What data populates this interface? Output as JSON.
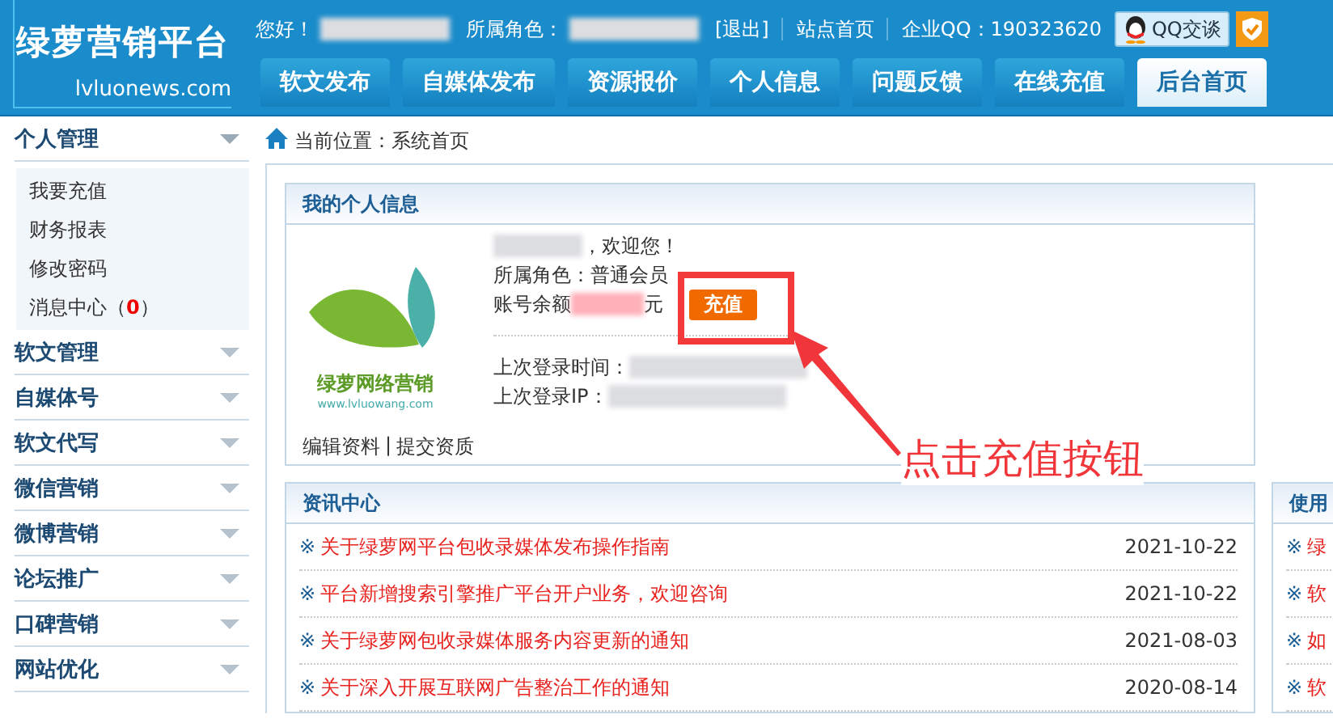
{
  "header": {
    "logo_title": "绿萝营销平台",
    "logo_domain": "lvluonews.com",
    "greeting": "您好！",
    "role_label": "所属角色：",
    "logout": "[退出]",
    "site_home": "站点首页",
    "company_qq": "企业QQ：190323620",
    "qq_chat": "QQ交谈"
  },
  "tabs": [
    {
      "label": "软文发布",
      "selected": false
    },
    {
      "label": "自媒体发布",
      "selected": false
    },
    {
      "label": "资源报价",
      "selected": false
    },
    {
      "label": "个人信息",
      "selected": false
    },
    {
      "label": "问题反馈",
      "selected": false
    },
    {
      "label": "在线充值",
      "selected": false
    },
    {
      "label": "后台首页",
      "selected": true
    }
  ],
  "sidebar": {
    "groups": [
      {
        "title": "个人管理",
        "expanded": true,
        "items": [
          {
            "label": "我要充值"
          },
          {
            "label": "财务报表"
          },
          {
            "label": "修改密码"
          },
          {
            "label": "消息中心（",
            "count": "0",
            "suffix": "）"
          }
        ]
      },
      {
        "title": "软文管理",
        "expanded": false
      },
      {
        "title": "自媒体号",
        "expanded": false
      },
      {
        "title": "软文代写",
        "expanded": false
      },
      {
        "title": "微信营销",
        "expanded": false
      },
      {
        "title": "微博营销",
        "expanded": false
      },
      {
        "title": "论坛推广",
        "expanded": false
      },
      {
        "title": "口碑营销",
        "expanded": false
      },
      {
        "title": "网站优化",
        "expanded": false
      }
    ]
  },
  "breadcrumb": "当前位置：系统首页",
  "profile": {
    "title": "我的个人信息",
    "logo_text": "绿萝网络营销",
    "logo_url": "www.lvluowang.com",
    "welcome": "，欢迎您！",
    "role": "所属角色：普通会员",
    "balance_label": "账号余额",
    "balance_unit": "元",
    "recharge_button": "充值",
    "last_login_time": "上次登录时间：",
    "last_login_ip": "上次登录IP：",
    "edit_link": "编辑资料",
    "separator": "|",
    "qualification_link": "提交资质"
  },
  "news": {
    "title": "资讯中心",
    "items": [
      {
        "mark": "※",
        "title": "关于绿萝网平台包收录媒体发布操作指南",
        "date": "2021-10-22"
      },
      {
        "mark": "※",
        "title": "平台新增搜索引擎推广平台开户业务，欢迎咨询",
        "date": "2021-10-22"
      },
      {
        "mark": "※",
        "title": "关于绿萝网包收录媒体服务内容更新的通知",
        "date": "2021-08-03"
      },
      {
        "mark": "※",
        "title": "关于深入开展互联网广告整治工作的通知",
        "date": "2020-08-14"
      }
    ]
  },
  "side_panel": {
    "title": "使用",
    "items": [
      {
        "mark": "※",
        "title": "绿"
      },
      {
        "mark": "※",
        "title": "软"
      },
      {
        "mark": "※",
        "title": "如"
      },
      {
        "mark": "※",
        "title": "软"
      }
    ]
  },
  "annotation": {
    "text": "点击充值按钮"
  }
}
